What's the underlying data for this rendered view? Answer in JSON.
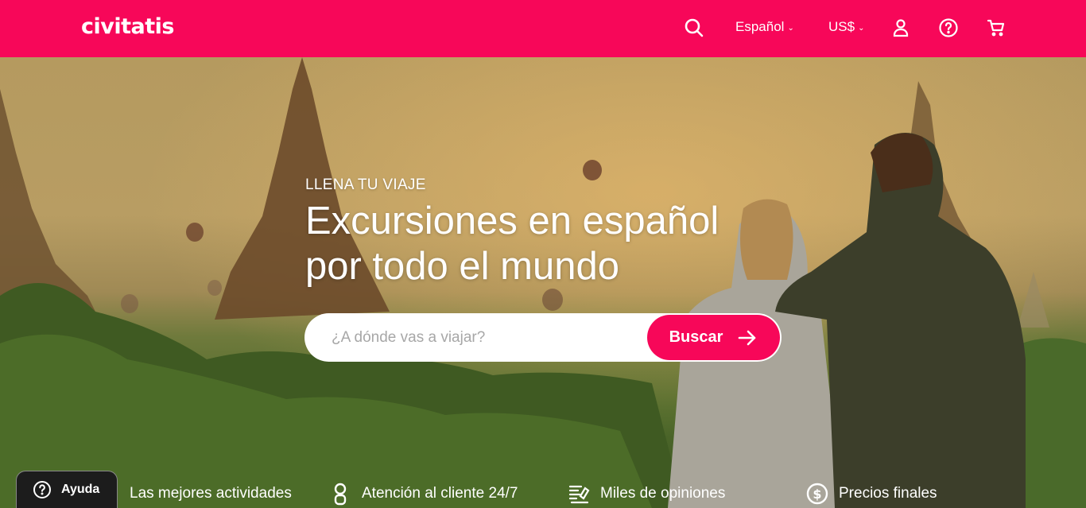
{
  "header": {
    "logo": "civitatis",
    "language": "Español",
    "currency": "US$",
    "icons": [
      "search-icon",
      "user-icon",
      "help-icon",
      "cart-icon"
    ]
  },
  "hero": {
    "eyebrow": "LLENA TU VIAJE",
    "headline": "Excursiones en español por todo el mundo",
    "search_placeholder": "¿A dónde vas a viajar?",
    "search_button": "Buscar"
  },
  "features": [
    {
      "label": "Las mejores actividades",
      "icon": "activities-icon"
    },
    {
      "label": "Atención al cliente 24/7",
      "icon": "support-icon"
    },
    {
      "label": "Miles de opiniones",
      "icon": "reviews-icon"
    },
    {
      "label": "Precios finales",
      "icon": "dollar-icon"
    }
  ],
  "help_button": "Ayuda",
  "colors": {
    "brand": "#f70759",
    "help_bg": "#1c1c1c"
  }
}
